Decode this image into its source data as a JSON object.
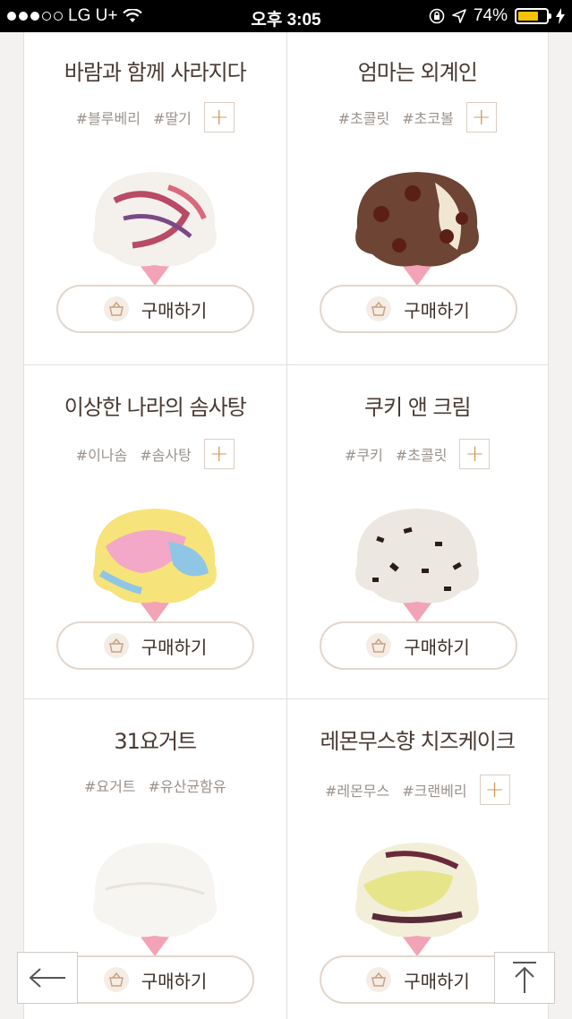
{
  "status_bar": {
    "carrier": "LG U+",
    "time": "오후 3:05",
    "battery_percent": "74%",
    "battery_level": 0.74
  },
  "products": [
    {
      "name": "바람과 함께 사라지다",
      "tags": [
        "#블루베리",
        "#딸기"
      ],
      "has_more_tags": true,
      "buy_label": "구매하기"
    },
    {
      "name": "엄마는 외계인",
      "tags": [
        "#초콜릿",
        "#초코볼"
      ],
      "has_more_tags": true,
      "buy_label": "구매하기"
    },
    {
      "name": "이상한 나라의 솜사탕",
      "tags": [
        "#이나솜",
        "#솜사탕"
      ],
      "has_more_tags": true,
      "buy_label": "구매하기"
    },
    {
      "name": "쿠키 앤 크림",
      "tags": [
        "#쿠키",
        "#초콜릿"
      ],
      "has_more_tags": true,
      "buy_label": "구매하기"
    },
    {
      "name": "31요거트",
      "tags": [
        "#요거트",
        "#유산균함유"
      ],
      "has_more_tags": false,
      "buy_label": "구매하기"
    },
    {
      "name": "레몬무스향 치즈케이크",
      "tags": [
        "#레몬무스",
        "#크랜베리"
      ],
      "has_more_tags": true,
      "buy_label": "구매하기"
    }
  ],
  "icons": {
    "plus": "+",
    "back": "back-arrow-icon",
    "top": "scroll-top-icon",
    "basket": "basket-icon"
  },
  "colors": {
    "accent": "#d19a57",
    "text": "#4a3a33",
    "tag": "#9a918b",
    "border": "#e3e0dc"
  }
}
